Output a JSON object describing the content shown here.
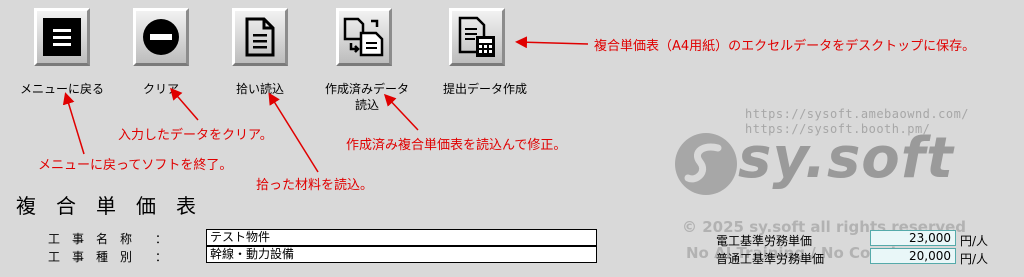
{
  "toolbar": {
    "menu_label": "メニューに戻る",
    "clear_label": "クリア",
    "pickup_label": "拾い読込",
    "created_label_line1": "作成済みデータ",
    "created_label_line2": "読込",
    "submit_label": "提出データ作成"
  },
  "annotations": {
    "save_excel": "複合単価表（A4用紙）のエクセルデータをデスクトップに保存。",
    "clear_data": "入力したデータをクリア。",
    "load_created": "作成済み複合単価表を読込んで修正。",
    "back_menu": "メニューに戻ってソフトを終了。",
    "load_pickup": "拾った材料を読込。"
  },
  "brand": {
    "url1": "https://sysoft.amebaownd.com/",
    "url2": "https://sysoft.booth.pm/",
    "logo_text": "sy.soft",
    "copyright": "© 2025 sy.soft all rights reserved",
    "no_ai": "No AI Training / No Copying"
  },
  "form": {
    "title": "複合単価表",
    "project_name_label": "工事名称",
    "project_type_label": "工事種別",
    "colon": "：",
    "project_name_value": "テスト物件",
    "project_type_value": "幹線・動力設備"
  },
  "rates": {
    "electrician_label": "電工基準労務単価",
    "electrician_value": "23,000",
    "laborer_label": "普通工基準労務単価",
    "laborer_value": "20,000",
    "unit": "円/人"
  },
  "colors": {
    "annotation": "#e00000",
    "watermark": "#a7a7a7",
    "background": "#d9d9d9"
  }
}
